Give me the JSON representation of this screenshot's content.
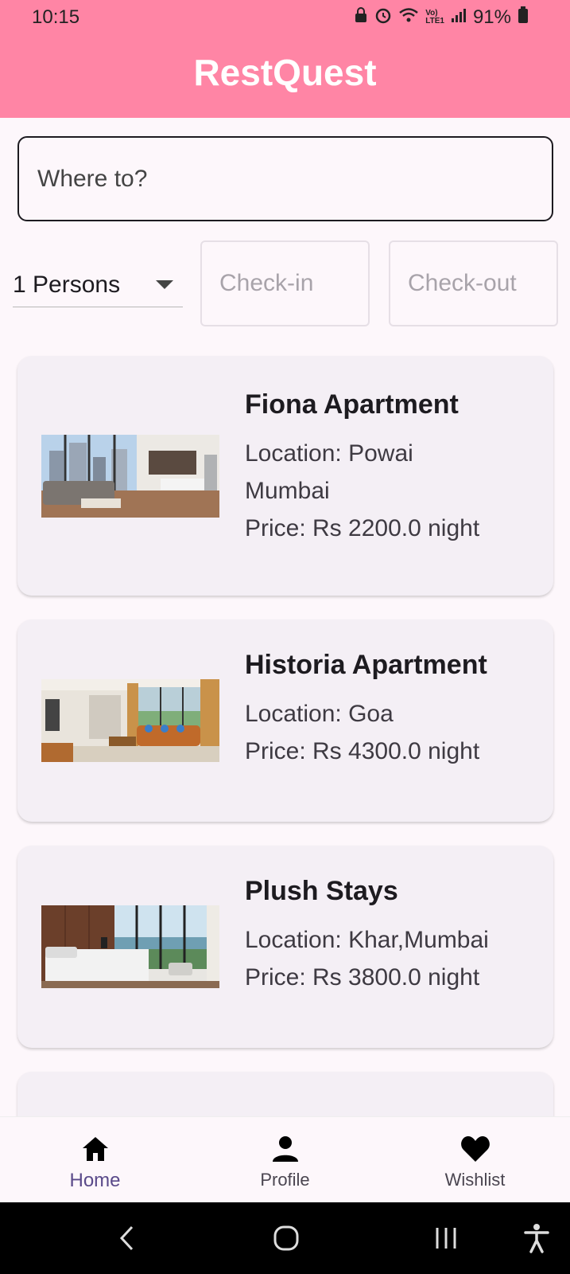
{
  "status_bar": {
    "time": "10:15",
    "battery": "91%",
    "icons": [
      "lock-icon",
      "alarm-icon",
      "wifi-icon",
      "lte-icon",
      "signal-icon",
      "battery-icon"
    ]
  },
  "app_bar": {
    "title": "RestQuest",
    "background_color": "#ff85a5"
  },
  "search": {
    "placeholder": "Where to?"
  },
  "filters": {
    "persons": "1 Persons",
    "check_in_placeholder": "Check-in",
    "check_out_placeholder": "Check-out"
  },
  "listings": [
    {
      "title": "Fiona Apartment",
      "location": "Location: Powai Mumbai",
      "location_line1": "Location: Powai",
      "location_line2": "Mumbai",
      "price": "Price: Rs 2200.0 night"
    },
    {
      "title": "Historia Apartment",
      "location": "Location: Goa",
      "price": "Price: Rs 4300.0 night"
    },
    {
      "title": "Plush Stays",
      "location": "Location: Khar,Mumbai",
      "price": "Price: Rs 3800.0 night"
    }
  ],
  "bottom_nav": {
    "items": [
      {
        "label": "Home",
        "icon": "home-icon",
        "active": true
      },
      {
        "label": "Profile",
        "icon": "person-icon",
        "active": false
      },
      {
        "label": "Wishlist",
        "icon": "heart-icon",
        "active": false
      }
    ]
  },
  "system_nav": {
    "icons": [
      "back-icon",
      "home-circle-icon",
      "recents-icon",
      "accessibility-icon"
    ]
  }
}
